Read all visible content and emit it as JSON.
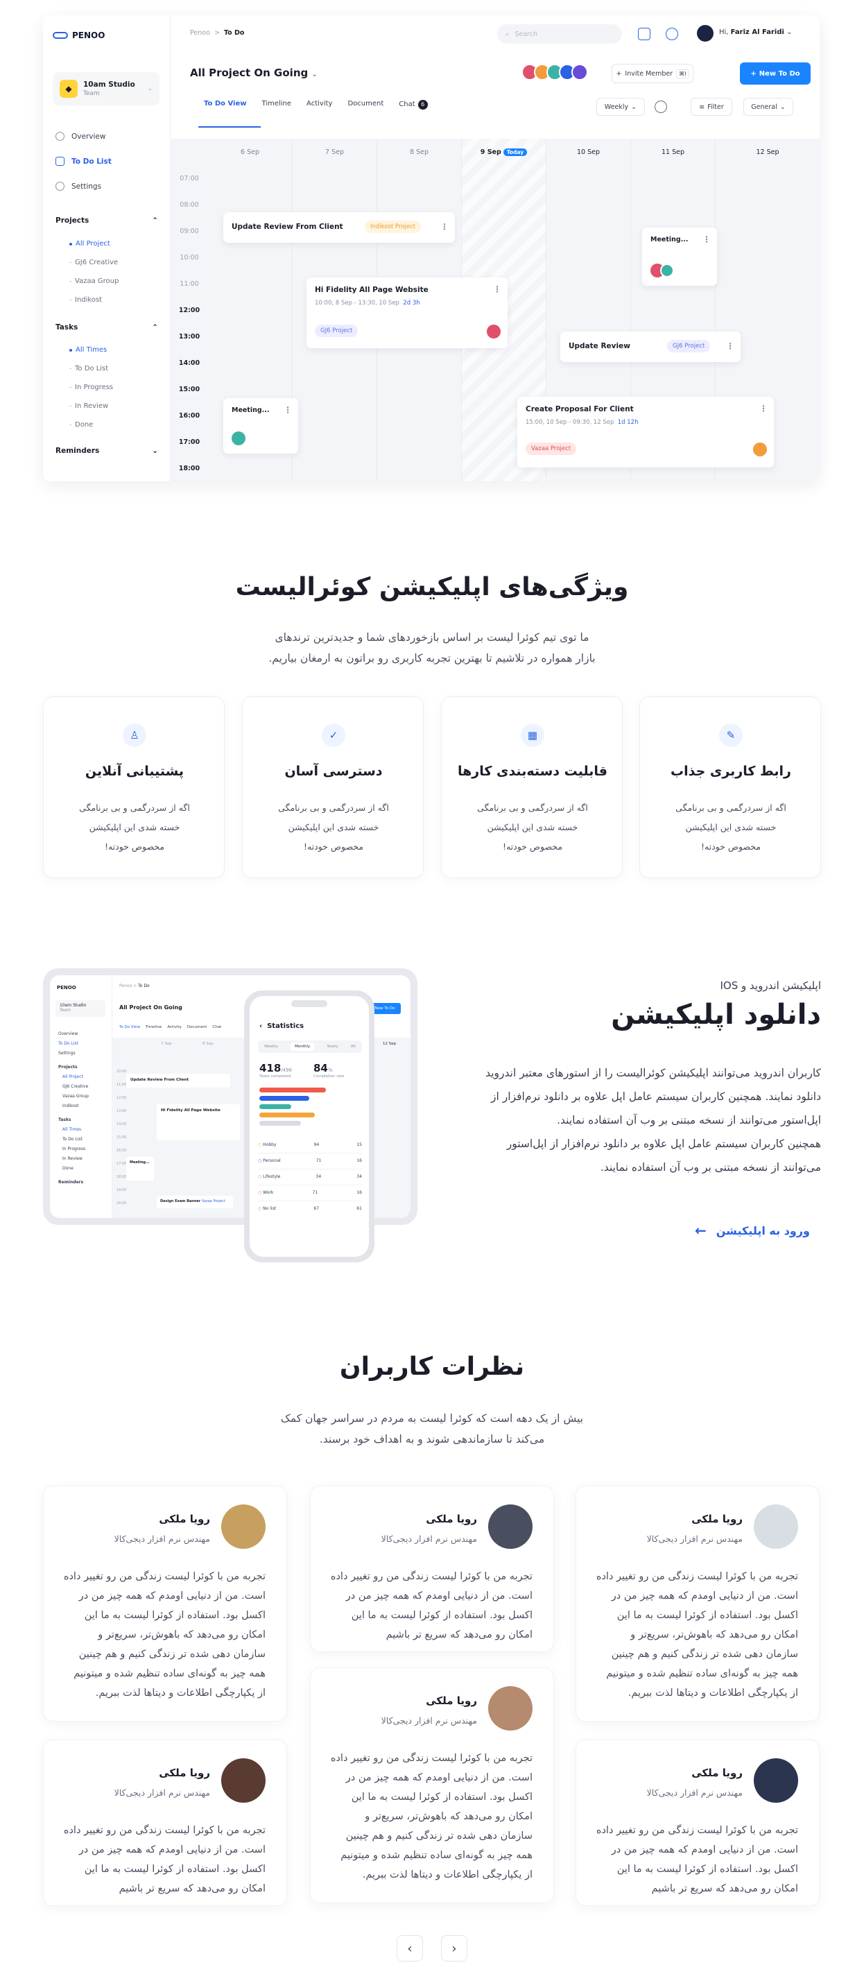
{
  "app": {
    "logo": "PENOO",
    "team": {
      "name": "10am Studio",
      "sub": "Team"
    },
    "nav": [
      "Overview",
      "To Do List",
      "Settings"
    ],
    "projects": {
      "title": "Projects",
      "items": [
        "All Project",
        "GJ6 Creative",
        "Vazaa Group",
        "Indikost"
      ]
    },
    "tasks": {
      "title": "Tasks",
      "items": [
        "All Times",
        "To Do List",
        "In Progress",
        "In Review",
        "Done"
      ]
    },
    "reminders": "Reminders",
    "breadcrumb": {
      "root": "Penoo",
      "sep": ">",
      "current": "To Do"
    },
    "search_placeholder": "Search",
    "user_greeting": "Hi,",
    "user_name": "Fariz Al Faridi",
    "page_title": "All Project On Going",
    "invite": "Invite Member",
    "invite_kbd": "⌘I",
    "new_todo": "New To Do",
    "tabs": [
      "To Do View",
      "Timeline",
      "Activity",
      "Document",
      "Chat"
    ],
    "chat_count": "6",
    "view_select": "Weekly",
    "filter": "Filter",
    "general": "General",
    "days": [
      "6 Sep",
      "7 Sep",
      "8 Sep",
      "9 Sep",
      "10 Sep",
      "11 Sep",
      "12 Sep"
    ],
    "today_label": "Today",
    "times": [
      "07:00",
      "08:00",
      "09:00",
      "10:00",
      "11:00",
      "12:00",
      "13:00",
      "14:00",
      "15:00",
      "16:00",
      "17:00",
      "18:00"
    ],
    "cards": {
      "c1": {
        "title": "Update Review From Client",
        "tag": "Indikost Project"
      },
      "c2": {
        "title": "Hi Fidelity All Page Website",
        "meta": "10:00, 8 Sep - 13:30, 10 Sep",
        "dur": "2d 3h",
        "tag": "GJ6 Project"
      },
      "c3": {
        "title": "Meeting..."
      },
      "c4": {
        "title": "Update Review",
        "tag": "GJ6 Project"
      },
      "c5": {
        "title": "Meeting..."
      },
      "c6": {
        "title": "Create Proposal For Client",
        "meta": "15:00, 10 Sep - 09:30, 12 Sep",
        "dur": "1d 12h",
        "tag": "Vazaa Project"
      }
    }
  },
  "features": {
    "title": "ویژگی‌های اپلیکیشن کوئرالیست",
    "lead_1": "ما توی تیم کوئرا لیست بر اساس بازخوردهای شما و جدیدترین ترندهای",
    "lead_2": "بازار همواره در تلاشیم تا بهترین تجربه کاربری رو براتون به ارمغان بیاریم.",
    "cards": [
      {
        "title": "پشتیبانی آنلاین",
        "d1": "اگه از سردرگمی و بی برنامگی",
        "d2": "خسته شدی این اپلیکیشن",
        "d3": "مخصوص خودته!"
      },
      {
        "title": "دسترسی آسان",
        "d1": "اگه از سردرگمی و بی برنامگی",
        "d2": "خسته شدی این اپلیکیشن",
        "d3": "مخصوص خودته!"
      },
      {
        "title": "قابلیت دسته‌بندی کارها",
        "d1": "اگه از سردرگمی و بی برنامگی",
        "d2": "خسته شدی این اپلیکیشن",
        "d3": "مخصوص خودته!"
      },
      {
        "title": "رابط کاربری جذاب",
        "d1": "اگه از سردرگمی و بی برنامگی",
        "d2": "خسته شدی این اپلیکیشن",
        "d3": "مخصوص خودته!"
      }
    ]
  },
  "download": {
    "subtitle": "اپلیکیشن اندروید و IOS",
    "title": "دانلود اپلیکیشن",
    "p1": "کاربران اندروید می‌توانند اپلیکیشن کوئرالیست را از استورهای معتبر اندروید دانلود نمایند. همچنین کاربران سیستم عامل اپل علاوه بر دانلود نرم‌افزار از اپل‌استور می‌توانند از نسخه مبتنی بر وب آن استفاده نمایند.",
    "p2": "همچنین کاربران سیستم عامل اپل علاوه بر دانلود نرم‌افزار از اپل‌استور می‌توانند از نسخه مبتنی بر وب آن استفاده نمایند.",
    "link": "ورود به اپلیکیشن",
    "phone": {
      "title": "Statistics",
      "tabs": [
        "Weekly",
        "Monthly",
        "Yearly",
        "All"
      ],
      "tasks_value": "418",
      "tasks_total": "/496",
      "tasks_label": "Tasks completed",
      "rate_value": "84",
      "rate_unit": "%",
      "rate_label": "Completion rate",
      "rows": [
        {
          "name": "Hobby",
          "value": "94",
          "right": "15"
        },
        {
          "name": "Personal",
          "value": "71",
          "right": "16"
        },
        {
          "name": "Lifestyle",
          "value": "34",
          "right": "34"
        },
        {
          "name": "Work",
          "value": "71",
          "right": "16"
        },
        {
          "name": "No list",
          "value": "67",
          "right": "61"
        }
      ]
    },
    "mini_days": [
      "7 Sep",
      "8 Sep"
    ],
    "mini_times": [
      "10:00",
      "11:00",
      "12:00",
      "13:00",
      "14:00",
      "15:00",
      "16:00",
      "17:00",
      "18:00",
      "19:00",
      "20:00"
    ],
    "mini_right_day": "12 Sep",
    "mini_extra_card": "Design Exam Banner",
    "mini_extra_tag": "Vazaa Project"
  },
  "testimonials": {
    "title": "نظرات کاربران",
    "lead_1": "بیش از یک دهه است که کوئرا لیست به مردم در سراسر جهان کمک",
    "lead_2": "می‌کند تا سازماندهی شوند و به اهداف خود برسند.",
    "name": "رویا ملکی",
    "role": "مهندس نرم افزار دیجی‌کالا",
    "text_long": "تجربه من با کوئرا لیست زندگی من رو تغییر داده است. من از دنیایی اومدم که همه چیز من در اکسل بود. استفاده از کوئرا لیست به ما این امکان رو می‌دهد که باهوش‌تر، سریع‌تر و سازمان دهی شده تر زندگی کنیم و هم چینین همه چیز به گونه‌ای ساده تنظیم شده و میتونیم از یکپارچگی اطلاعات و دیتاها لذت ببریم.",
    "text_short": "تجربه من با کوئرا لیست زندگی من رو تغییر داده است. من از دنیایی اومدم که همه چیز من در اکسل بود. استفاده از کوئرا لیست به ما این امکان رو می‌دهد که سریع تر باشیم"
  },
  "colors": {
    "accent": "#1a84ff",
    "brand": "#2b62e3",
    "text": "#1b1d29"
  }
}
